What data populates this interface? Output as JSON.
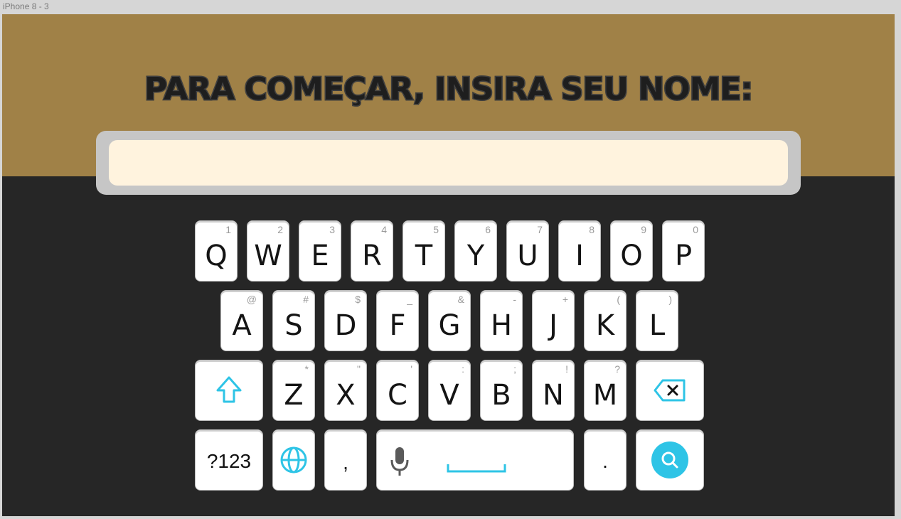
{
  "frame": {
    "label": "iPhone 8 - 3"
  },
  "header": {
    "title": "PARA COMEÇAR, INSIRA SEU NOME:"
  },
  "name_input": {
    "value": "",
    "placeholder": ""
  },
  "colors": {
    "header_bg": "#a08147",
    "body_bg": "#262626",
    "input_bg": "#fff3de",
    "accent": "#2ec4e6"
  },
  "keyboard": {
    "row1": [
      {
        "letter": "Q",
        "hint": "1"
      },
      {
        "letter": "W",
        "hint": "2"
      },
      {
        "letter": "E",
        "hint": "3"
      },
      {
        "letter": "R",
        "hint": "4"
      },
      {
        "letter": "T",
        "hint": "5"
      },
      {
        "letter": "Y",
        "hint": "6"
      },
      {
        "letter": "U",
        "hint": "7"
      },
      {
        "letter": "I",
        "hint": "8"
      },
      {
        "letter": "O",
        "hint": "9"
      },
      {
        "letter": "P",
        "hint": "0"
      }
    ],
    "row2": [
      {
        "letter": "A",
        "hint": "@"
      },
      {
        "letter": "S",
        "hint": "#"
      },
      {
        "letter": "D",
        "hint": "$"
      },
      {
        "letter": "F",
        "hint": "_"
      },
      {
        "letter": "G",
        "hint": "&"
      },
      {
        "letter": "H",
        "hint": "-"
      },
      {
        "letter": "J",
        "hint": "+"
      },
      {
        "letter": "K",
        "hint": "("
      },
      {
        "letter": "L",
        "hint": ")"
      }
    ],
    "row3": [
      {
        "letter": "Z",
        "hint": "*"
      },
      {
        "letter": "X",
        "hint": "\""
      },
      {
        "letter": "C",
        "hint": "'"
      },
      {
        "letter": "V",
        "hint": ":"
      },
      {
        "letter": "B",
        "hint": ";"
      },
      {
        "letter": "N",
        "hint": "!"
      },
      {
        "letter": "M",
        "hint": "?"
      }
    ],
    "symbols_key": "?123",
    "comma_key": ",",
    "period_key": ".",
    "icons": {
      "shift": "shift-arrow-icon",
      "backspace": "backspace-icon",
      "globe": "globe-icon",
      "mic": "microphone-icon",
      "search": "search-icon"
    }
  }
}
